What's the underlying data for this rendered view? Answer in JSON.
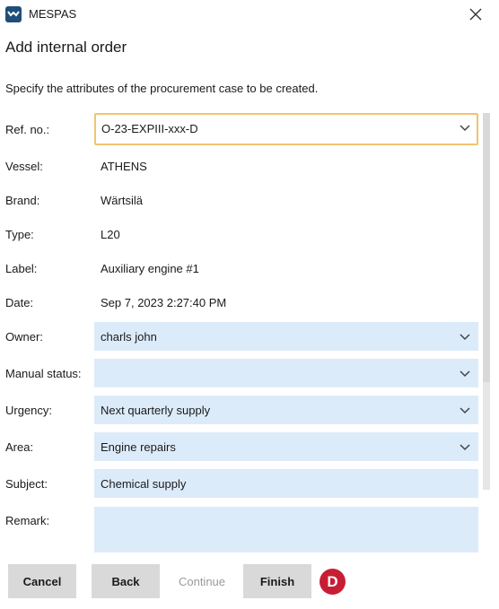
{
  "window": {
    "app_name": "MESPAS",
    "title": "Add internal order",
    "description": "Specify the attributes of the procurement case to be created."
  },
  "colors": {
    "field_bg": "#dcebfa",
    "focus_border": "#f2c46d",
    "button_bg": "#d9d9d9",
    "badge_bg": "#c81e35",
    "logo_bg": "#1f4e79"
  },
  "icons": {
    "logo": "mespas-logo-icon",
    "close": "close-icon",
    "dropdown": "chevron-down-icon"
  },
  "form": {
    "ref_no": {
      "label": "Ref. no.:",
      "value": "O-23-EXPIII-xxx-D"
    },
    "vessel": {
      "label": "Vessel:",
      "value": "ATHENS"
    },
    "brand": {
      "label": "Brand:",
      "value": "Wärtsilä"
    },
    "type": {
      "label": "Type:",
      "value": "L20"
    },
    "label_field": {
      "label": "Label:",
      "value": "Auxiliary engine #1"
    },
    "date": {
      "label": "Date:",
      "value": "Sep 7, 2023 2:27:40 PM"
    },
    "owner": {
      "label": "Owner:",
      "value": "charls john"
    },
    "manual_status": {
      "label": "Manual status:",
      "value": ""
    },
    "urgency": {
      "label": "Urgency:",
      "value": "Next quarterly supply"
    },
    "area": {
      "label": "Area:",
      "value": "Engine repairs"
    },
    "subject": {
      "label": "Subject:",
      "value": "Chemical supply"
    },
    "remark": {
      "label": "Remark:",
      "value": ""
    }
  },
  "buttons": {
    "cancel": "Cancel",
    "back": "Back",
    "continue": "Continue",
    "finish": "Finish"
  },
  "badge": "D"
}
